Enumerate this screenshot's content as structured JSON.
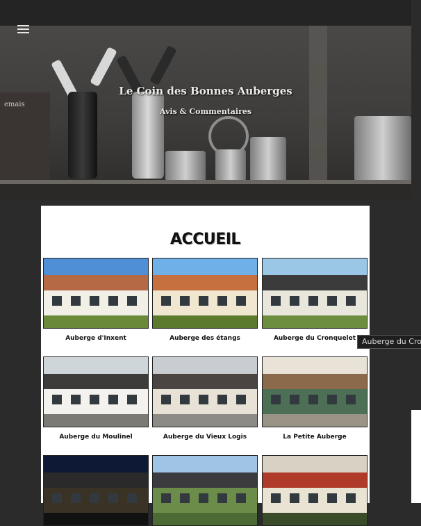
{
  "header": {
    "menu_icon": "hamburger-menu-icon",
    "site_title": "Le Coin des Bonnes Auberges",
    "site_subtitle": "Avis & Commentaires",
    "hero_box_text": "emais"
  },
  "main": {
    "heading": "ACCUEIL",
    "cards": [
      {
        "label": "Auberge d'Inxent",
        "colors": {
          "sky": "#4f8fd6",
          "roof": "#b56a45",
          "wall": "#f2efe6",
          "ground": "#6a8a3a"
        }
      },
      {
        "label": "Auberge des étangs",
        "colors": {
          "sky": "#6fb0e8",
          "roof": "#c7703f",
          "wall": "#f1e6d0",
          "ground": "#5b7a2e"
        }
      },
      {
        "label": "Auberge du Cronquelet",
        "colors": {
          "sky": "#9bc7e6",
          "roof": "#3b3b3b",
          "wall": "#e9e6dc",
          "ground": "#6e8e3f"
        }
      },
      {
        "label": "Auberge du Moulinel",
        "colors": {
          "sky": "#cfd6da",
          "roof": "#3e3c3a",
          "wall": "#f3f2ee",
          "ground": "#7b7a75"
        }
      },
      {
        "label": "Auberge du Vieux Logis",
        "colors": {
          "sky": "#c9ccd0",
          "roof": "#4a4443",
          "wall": "#e8e2d6",
          "ground": "#8d8b86"
        }
      },
      {
        "label": "La Petite Auberge",
        "colors": {
          "sky": "#e8e3d6",
          "roof": "#8a6a4a",
          "wall": "#4c6f55",
          "ground": "#9a9486"
        }
      },
      {
        "label": "",
        "colors": {
          "sky": "#0e1a35",
          "roof": "#2a2a2a",
          "wall": "#3a3225",
          "ground": "#111"
        }
      },
      {
        "label": "",
        "colors": {
          "sky": "#9fc4e6",
          "roof": "#3b3a3f",
          "wall": "#6c8d4a",
          "ground": "#4c6b34"
        }
      },
      {
        "label": "",
        "colors": {
          "sky": "#d8d2c4",
          "roof": "#b13b2b",
          "wall": "#e9e3d3",
          "ground": "#3a4b2a"
        }
      }
    ]
  },
  "tooltip": {
    "text": "Auberge du Cronquelet"
  }
}
